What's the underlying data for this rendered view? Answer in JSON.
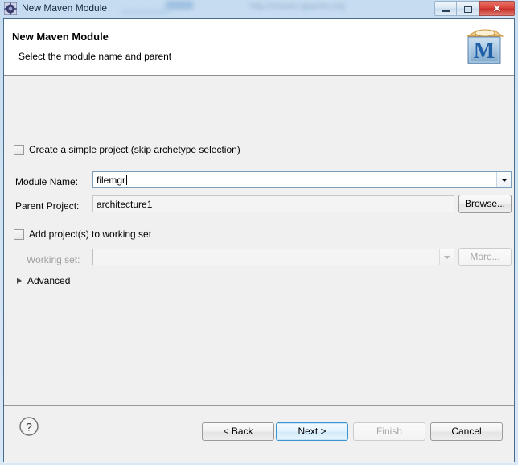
{
  "window": {
    "title": "New Maven Module",
    "icon": "maven-module-icon",
    "controls": {
      "minimize": "minimize-button",
      "maximize": "maximize-button",
      "close_glyph": "✕"
    }
  },
  "backdrop": {
    "url_text": "http://maven.apache.org"
  },
  "header": {
    "title": "New Maven Module",
    "subtitle": "Select the module name and parent",
    "banner_icon": "maven-banner-icon",
    "banner_letter": "M"
  },
  "form": {
    "simple_project": {
      "label": "Create a simple project (skip archetype selection)",
      "checked": false
    },
    "module_name": {
      "label": "Module Name:",
      "value": "filemgr",
      "placeholder": ""
    },
    "parent_project": {
      "label": "Parent Project:",
      "value": "architecture1",
      "browse_label": "Browse..."
    },
    "working_set_group": {
      "add_label": "Add project(s) to working set",
      "checked": false,
      "working_set_label": "Working set:",
      "working_set_value": "",
      "more_label": "More...",
      "disabled": true
    },
    "advanced": {
      "label": "Advanced",
      "expanded": false
    }
  },
  "footer": {
    "help": "?",
    "back_label": "< Back",
    "next_label": "Next >",
    "finish_label": "Finish",
    "cancel_label": "Cancel"
  },
  "colors": {
    "accent": "#3c94d1",
    "close": "#d9453a",
    "dialog_bg": "#f0f0f0",
    "header_bg": "#ffffff"
  }
}
